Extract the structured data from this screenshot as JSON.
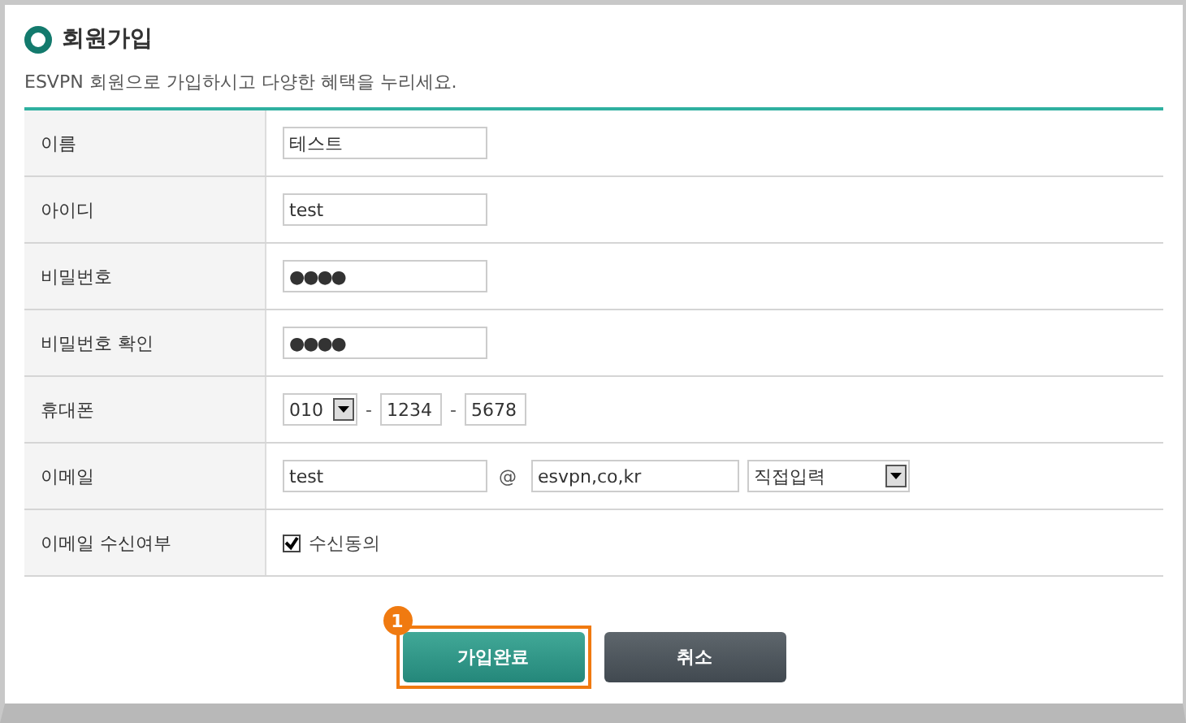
{
  "title": "회원가입",
  "description": "ESVPN 회원으로 가입하시고 다양한 혜택을 누리세요.",
  "rows": [
    {
      "kind": "text",
      "label": "이름",
      "value": "테스트"
    },
    {
      "kind": "text",
      "label": "아이디",
      "value": "test"
    },
    {
      "kind": "password",
      "label": "비밀번호",
      "value": "●●●●"
    },
    {
      "kind": "password",
      "label": "비밀번호 확인",
      "value": "●●●●"
    },
    {
      "kind": "phone",
      "label": "휴대폰",
      "prefix": "010",
      "separator_1": "-",
      "middle": "1234",
      "separator_2": "-",
      "last": "5678"
    },
    {
      "kind": "email",
      "label": "이메일",
      "local": "test",
      "at": "@",
      "domain": "esvpn,co,kr",
      "domain_select": "직접입력"
    },
    {
      "kind": "checkbox",
      "label": "이메일 수신여부",
      "checked": true,
      "text": "수신동의"
    }
  ],
  "buttons": [
    {
      "kind": "primary",
      "label": "가입완료",
      "highlighted": true,
      "badge": "1"
    },
    {
      "kind": "secondary",
      "label": "취소",
      "highlighted": false
    }
  ]
}
